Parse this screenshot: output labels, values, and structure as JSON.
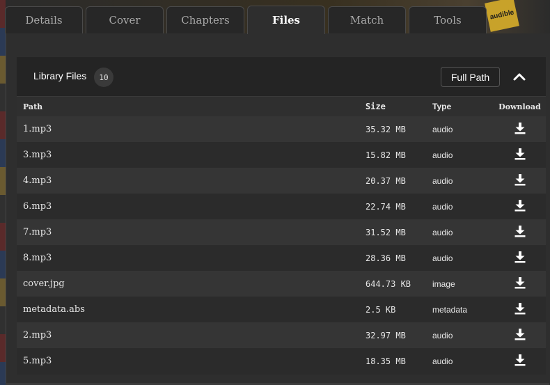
{
  "tabs": [
    {
      "label": "Details"
    },
    {
      "label": "Cover"
    },
    {
      "label": "Chapters"
    },
    {
      "label": "Files"
    },
    {
      "label": "Match"
    },
    {
      "label": "Tools"
    }
  ],
  "active_tab": "Files",
  "background": {
    "badge_text": "audible"
  },
  "panel": {
    "title": "Library Files",
    "count": "10",
    "full_path_label": "Full Path",
    "collapse_icon": "chevron-up-icon"
  },
  "table": {
    "headers": {
      "path": "Path",
      "size": "Size",
      "type": "Type",
      "download": "Download"
    },
    "rows": [
      {
        "path": "1.mp3",
        "size": "35.32 MB",
        "type": "audio"
      },
      {
        "path": "3.mp3",
        "size": "15.82 MB",
        "type": "audio"
      },
      {
        "path": "4.mp3",
        "size": "20.37 MB",
        "type": "audio"
      },
      {
        "path": "6.mp3",
        "size": "22.74 MB",
        "type": "audio"
      },
      {
        "path": "7.mp3",
        "size": "31.52 MB",
        "type": "audio"
      },
      {
        "path": "8.mp3",
        "size": "28.36 MB",
        "type": "audio"
      },
      {
        "path": "cover.jpg",
        "size": "644.73 KB",
        "type": "image"
      },
      {
        "path": "metadata.abs",
        "size": "2.5 KB",
        "type": "metadata"
      },
      {
        "path": "2.mp3",
        "size": "32.97 MB",
        "type": "audio"
      },
      {
        "path": "5.mp3",
        "size": "18.35 MB",
        "type": "audio"
      }
    ]
  },
  "colors": {
    "panel_bg": "#2a2a2a",
    "row_odd": "#353535",
    "row_even": "#2b2b2b",
    "text": "#e8e8e8"
  }
}
